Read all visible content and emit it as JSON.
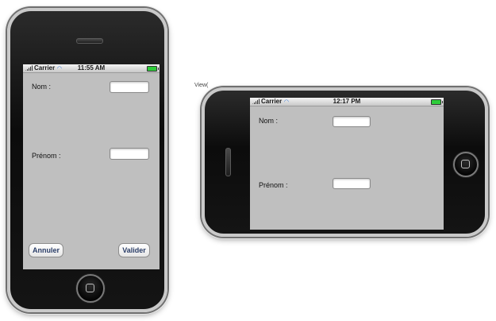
{
  "portrait": {
    "status": {
      "carrier": "Carrier",
      "time": "11:55 AM"
    },
    "nom_label": "Nom :",
    "prenom_label": "Prénom :",
    "cancel_label": "Annuler",
    "validate_label": "Valider"
  },
  "landscape": {
    "status": {
      "carrier": "Carrier",
      "time": "12:17 PM"
    },
    "nom_label": "Nom :",
    "prenom_label": "Prénom :"
  },
  "side_text": "View("
}
